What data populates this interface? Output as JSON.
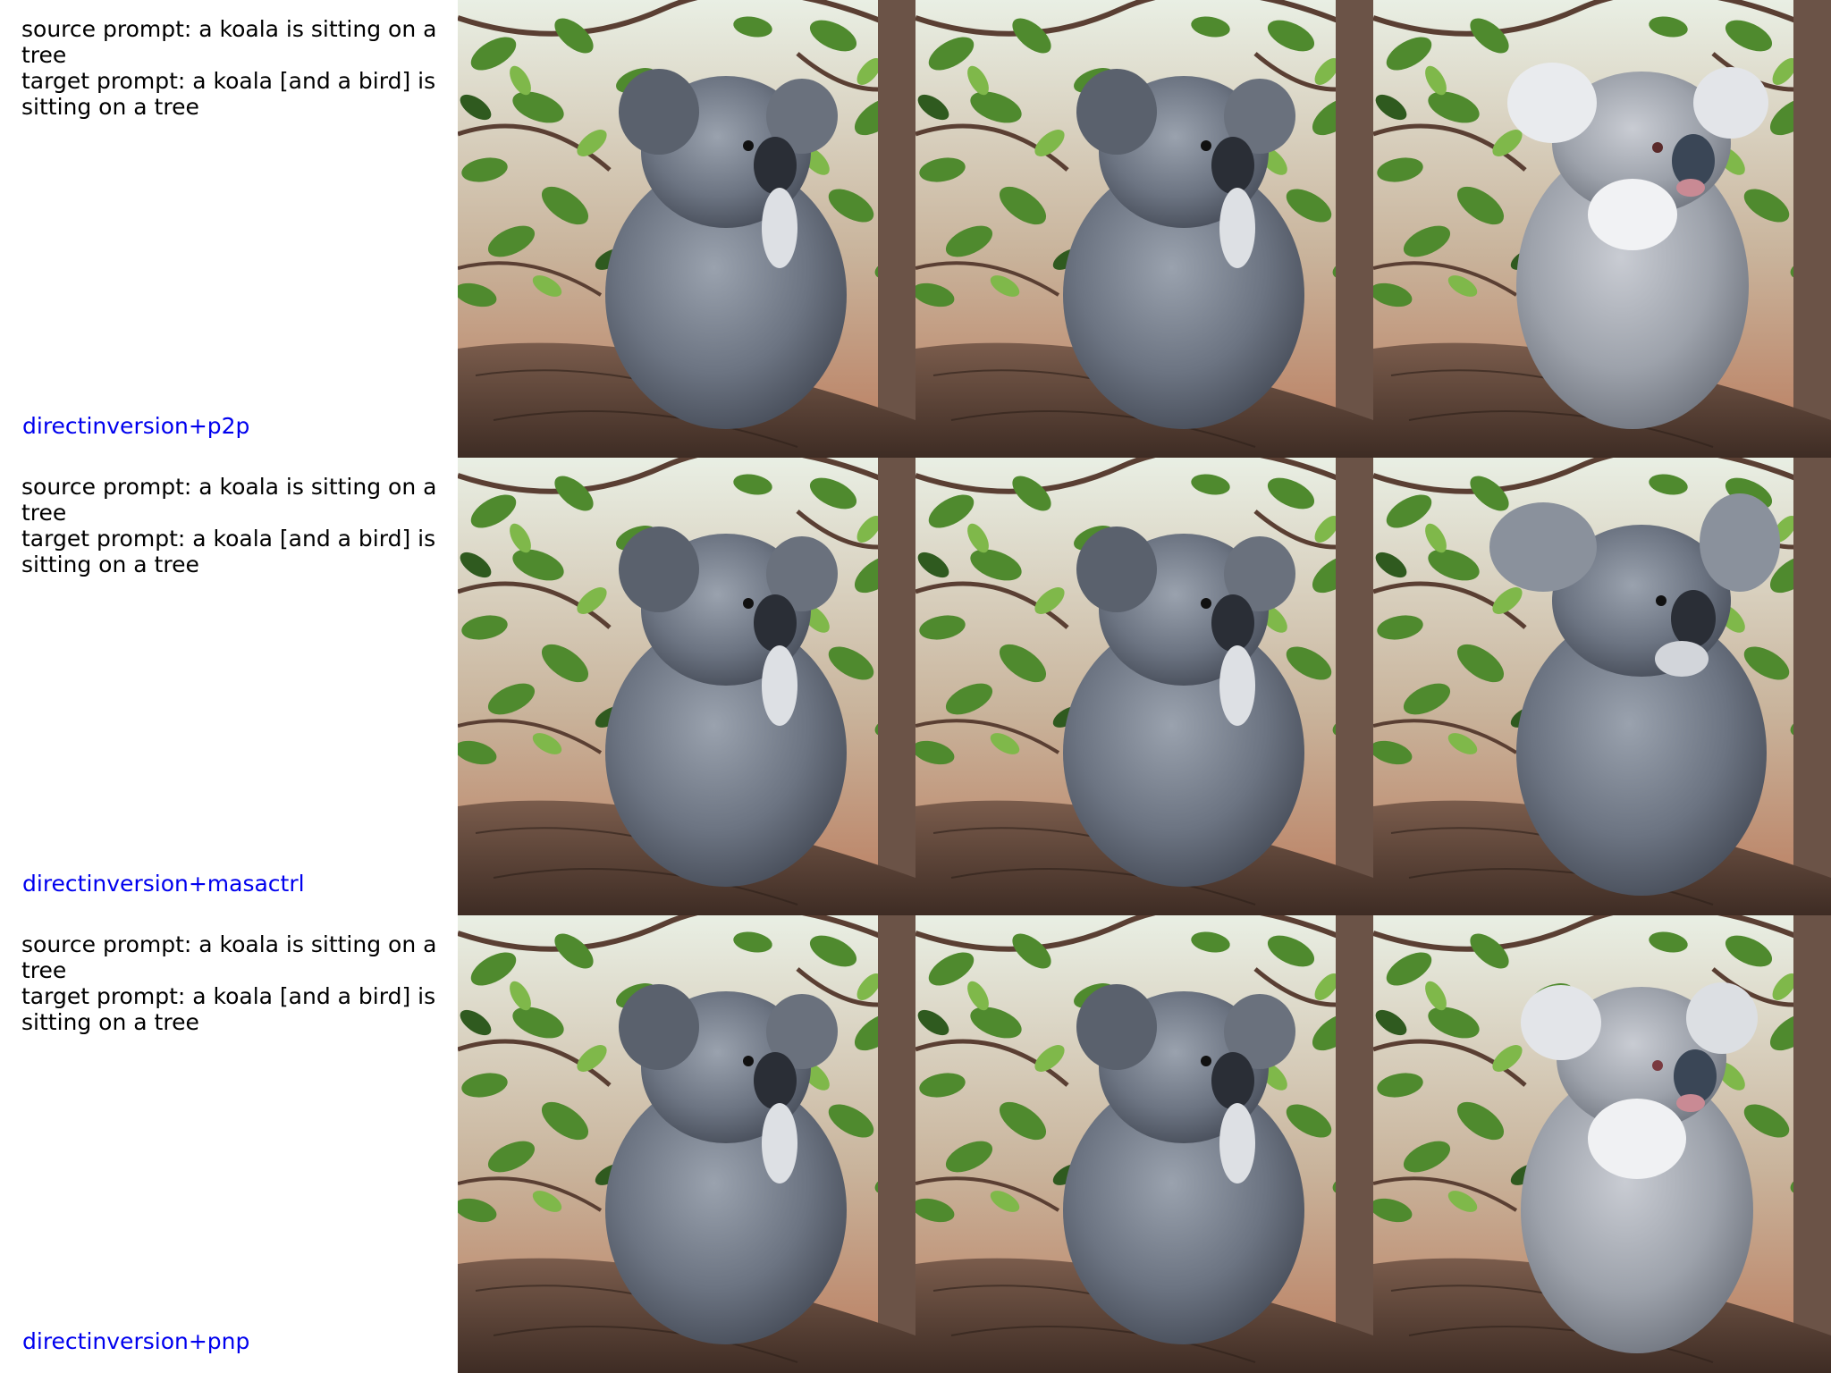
{
  "rows": [
    {
      "source_prompt": "source prompt: a koala is sitting on a tree",
      "target_prompt": "target prompt: a koala [and a bird] is sitting on a tree",
      "method": "directinversion+p2p"
    },
    {
      "source_prompt": "source prompt: a koala is sitting on a tree",
      "target_prompt": "target prompt: a koala [and a bird] is sitting on a tree",
      "method": "directinversion+masactrl"
    },
    {
      "source_prompt": "source prompt: a koala is sitting on a tree",
      "target_prompt": "target prompt: a koala [and a bird] is sitting on a tree",
      "method": "directinversion+pnp"
    }
  ],
  "colors": {
    "method_label": "#0000ee",
    "prompt_text": "#000000",
    "foliage": "#4f8a2e",
    "branch": "#5c4335",
    "koala_fur": "#6f7785"
  }
}
